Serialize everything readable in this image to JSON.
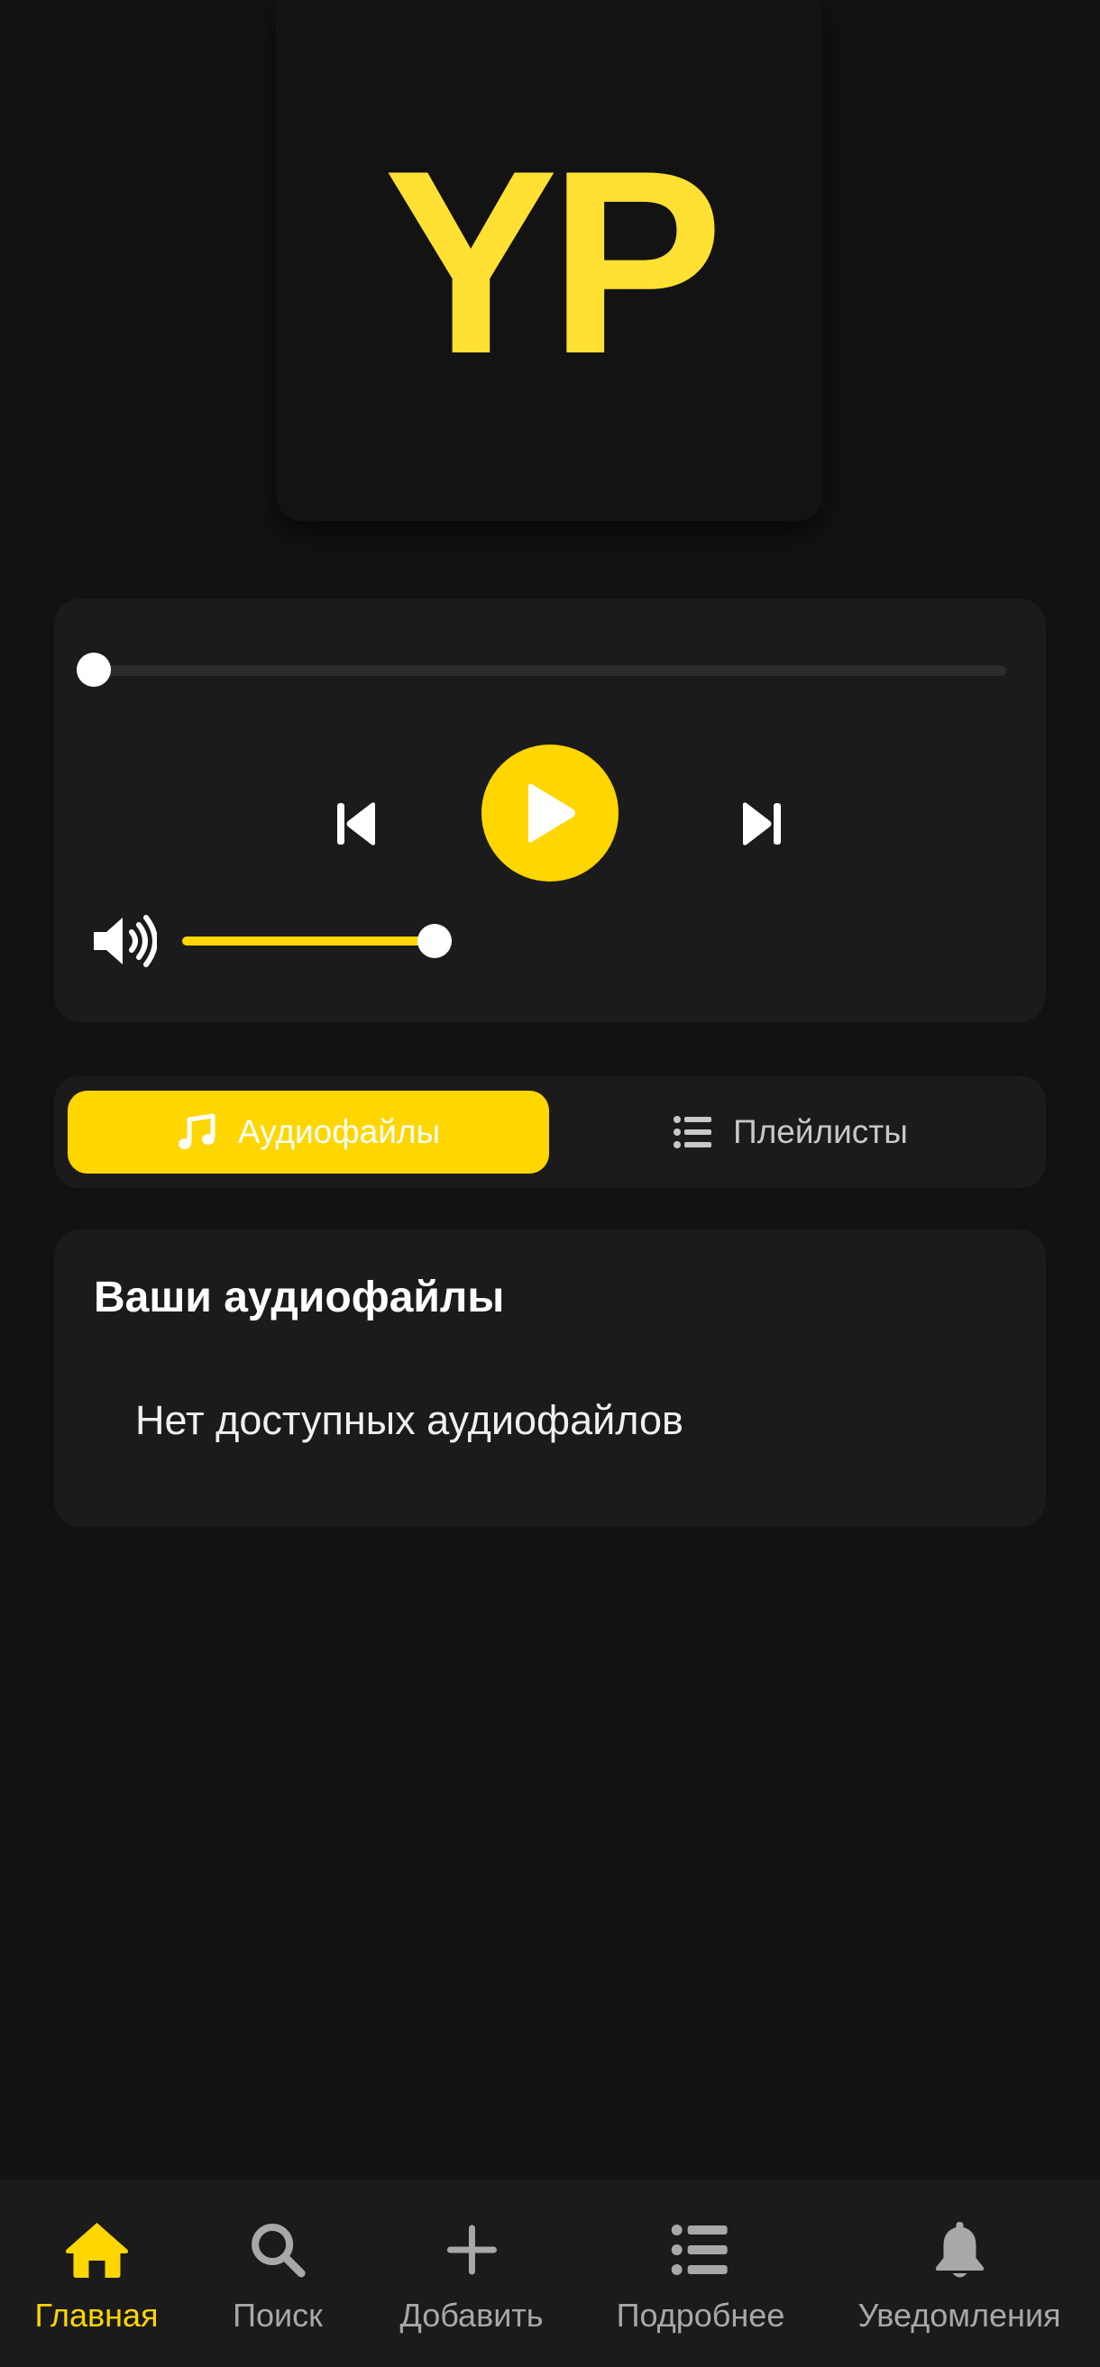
{
  "logo": {
    "text": "YP",
    "color": "#ffe033"
  },
  "player": {
    "progress": 0.0,
    "volume": 1.0,
    "accent": "#ffd600",
    "icons": {
      "prev": "skip-previous-icon",
      "play": "play-icon",
      "next": "skip-next-icon",
      "volume": "volume-up-icon"
    }
  },
  "tabs": [
    {
      "label": "Аудиофайлы",
      "icon": "music-note-icon",
      "active": true
    },
    {
      "label": "Плейлисты",
      "icon": "list-icon",
      "active": false
    }
  ],
  "audio_list": {
    "title": "Ваши аудиофайлы",
    "empty_message": "Нет доступных аудиофайлов"
  },
  "bottom_nav": [
    {
      "label": "Главная",
      "icon": "home-icon",
      "active": true
    },
    {
      "label": "Поиск",
      "icon": "search-icon",
      "active": false
    },
    {
      "label": "Добавить",
      "icon": "plus-icon",
      "active": false
    },
    {
      "label": "Подробнее",
      "icon": "list-icon",
      "active": false
    },
    {
      "label": "Уведомления",
      "icon": "bell-icon",
      "active": false
    }
  ],
  "colors": {
    "background": "#121212",
    "card": "#1b1b1b",
    "accent": "#ffd600",
    "inactive_text": "#a8a8a8"
  }
}
